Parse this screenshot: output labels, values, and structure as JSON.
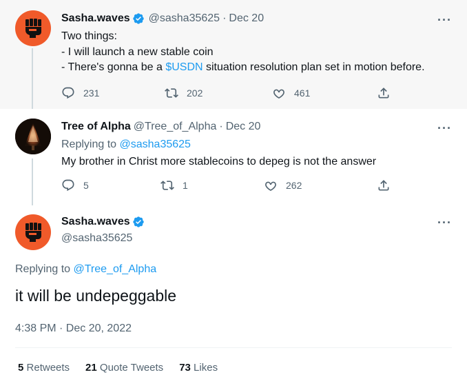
{
  "tweets": [
    {
      "name": "Sasha.waves",
      "handle": "@sasha35625",
      "sep": "·",
      "date": "Dec 20",
      "lines": [
        "Two things:",
        "- I will launch a new stable coin"
      ],
      "line3_prefix": "- There's gonna be a ",
      "line3_link": "$USDN",
      "line3_suffix": " situation resolution plan set in motion before.",
      "replies": "231",
      "retweets": "202",
      "likes": "461"
    },
    {
      "name": "Tree of Alpha",
      "handle": "@Tree_of_Alpha",
      "sep": "·",
      "date": "Dec 20",
      "replying_prefix": "Replying to ",
      "replying_handle": "@sasha35625",
      "text": "My brother in Christ more stablecoins to depeg is not the answer",
      "replies": "5",
      "retweets": "1",
      "likes": "262"
    },
    {
      "name": "Sasha.waves",
      "handle": "@sasha35625",
      "replying_prefix": "Replying to ",
      "replying_handle": "@Tree_of_Alpha",
      "text": "it will be undepeggable",
      "timestamp": "4:38 PM · Dec 20, 2022",
      "stats": {
        "retweets_count": "5",
        "retweets_label": "Retweets",
        "quotes_count": "21",
        "quotes_label": "Quote Tweets",
        "likes_count": "73",
        "likes_label": "Likes"
      }
    }
  ],
  "more_glyph": "···",
  "colors": {
    "link": "#1d9bf0",
    "verified": "#1d9bf0",
    "avatar_orange": "#f05a2a",
    "muted": "#536471"
  },
  "icons": [
    "reply-icon",
    "retweet-icon",
    "like-icon",
    "share-icon",
    "verified-badge-icon",
    "fist-icon",
    "more-icon"
  ]
}
